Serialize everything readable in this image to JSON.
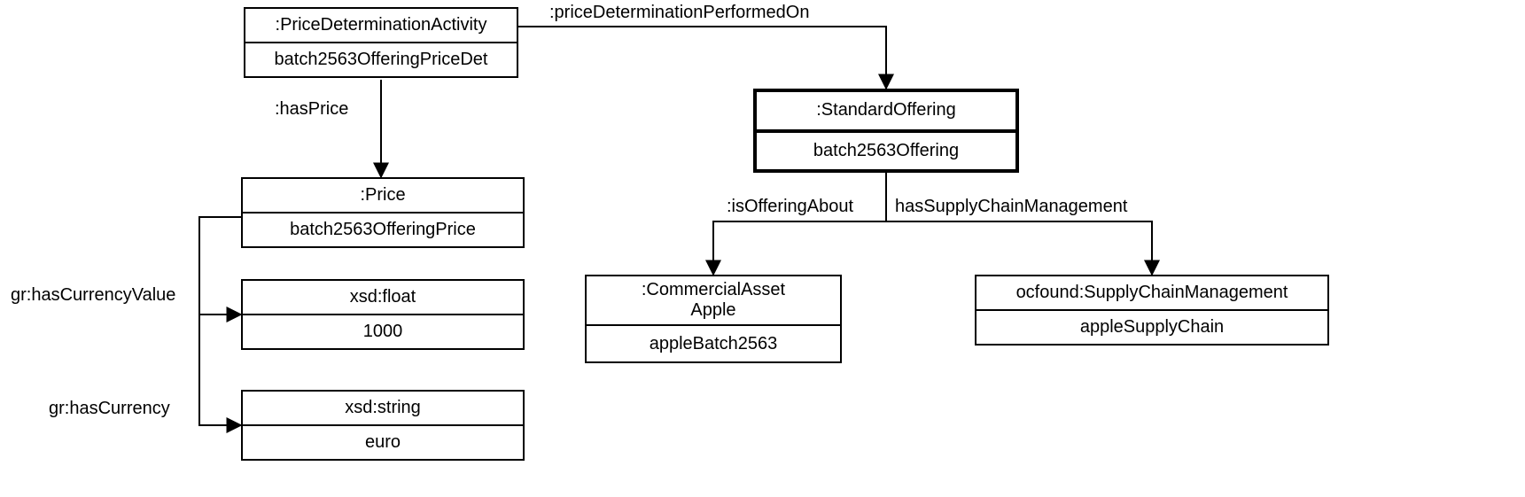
{
  "nodes": {
    "priceDetAct": {
      "type": ":PriceDeterminationActivity",
      "instance": "batch2563OfferingPriceDet"
    },
    "standardOffering": {
      "type": ":StandardOffering",
      "instance": "batch2563Offering"
    },
    "price": {
      "type": ":Price",
      "instance": "batch2563OfferingPrice"
    },
    "currencyValue": {
      "type": "xsd:float",
      "value": "1000"
    },
    "currency": {
      "type": "xsd:string",
      "value": "euro"
    },
    "commercialAsset": {
      "type": ":CommercialAsset\nApple",
      "instance": "appleBatch2563"
    },
    "supplyChain": {
      "type": "ocfound:SupplyChainManagement",
      "instance": "appleSupplyChain"
    }
  },
  "edges": {
    "hasPrice": ":hasPrice",
    "priceDetPerformedOn": ":priceDeterminationPerformedOn",
    "isOfferingAbout": ":isOfferingAbout",
    "hasSupplyChain": "hasSupplyChainManagement",
    "hasCurrencyValue": "gr:hasCurrencyValue",
    "hasCurrency": "gr:hasCurrency"
  }
}
